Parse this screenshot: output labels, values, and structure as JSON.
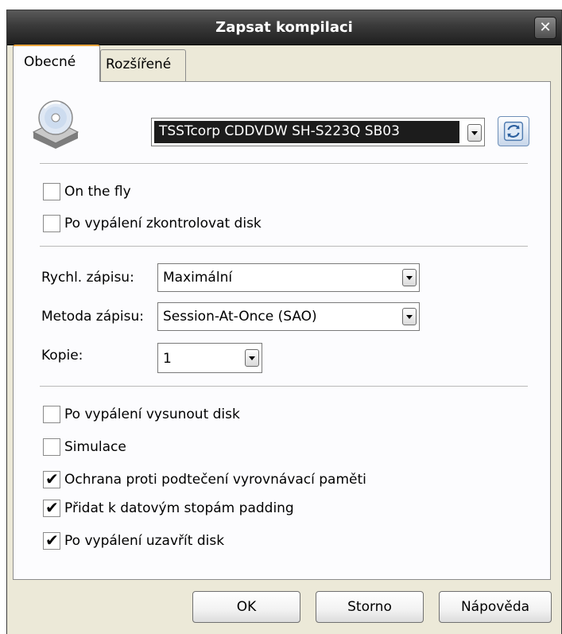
{
  "window": {
    "title": "Zapsat kompilaci",
    "close_glyph": "✕"
  },
  "tabs": [
    {
      "label": "Obecné",
      "active": true
    },
    {
      "label": "Rozšířené",
      "active": false
    }
  ],
  "drive": {
    "icon": "cd-drive-icon",
    "selected": "TSSTcorp CDDVDW SH-S223Q SB03",
    "refresh_icon": "refresh-icon"
  },
  "options_top": [
    {
      "label": "On the fly",
      "checked": false
    },
    {
      "label": "Po vypálení zkontrolovat disk",
      "checked": false
    }
  ],
  "settings": {
    "speed_label": "Rychl. zápisu:",
    "speed_value": "Maximální",
    "method_label": "Metoda zápisu:",
    "method_value": "Session-At-Once (SAO)",
    "copies_label": "Kopie:",
    "copies_value": "1"
  },
  "options_bottom": [
    {
      "label": "Po vypálení vysunout disk",
      "checked": false
    },
    {
      "label": "Simulace",
      "checked": false
    },
    {
      "label": "Ochrana proti podtečení vyrovnávací paměti",
      "checked": true
    },
    {
      "label": "Přidat k datovým stopám padding",
      "checked": true
    },
    {
      "label": "Po vypálení uzavřít disk",
      "checked": true
    }
  ],
  "buttons": {
    "ok": "OK",
    "cancel": "Storno",
    "help": "Nápověda"
  },
  "check_glyph": "✔"
}
